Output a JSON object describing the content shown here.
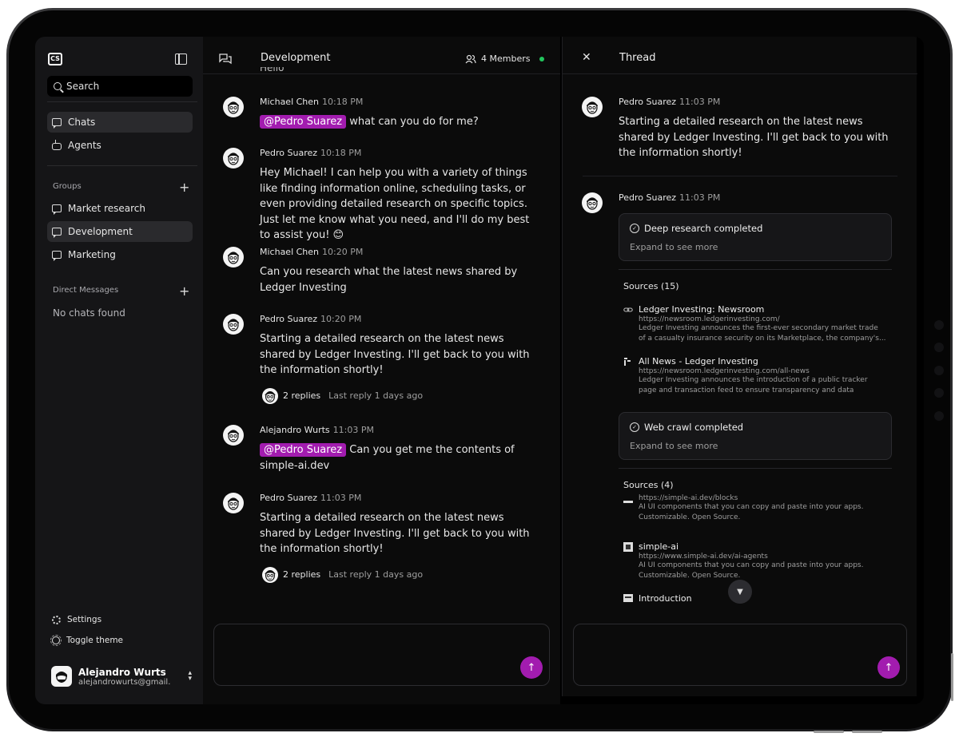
{
  "sidebar": {
    "logo_text": "CS",
    "search_label": "Search",
    "nav": [
      {
        "label": "Chats",
        "icon": "chat-icon",
        "active": true
      },
      {
        "label": "Agents",
        "icon": "bot-icon",
        "active": false
      }
    ],
    "groups_label": "Groups",
    "groups": [
      {
        "label": "Market research",
        "active": false
      },
      {
        "label": "Development",
        "active": true
      },
      {
        "label": "Marketing",
        "active": false
      }
    ],
    "dm_label": "Direct Messages",
    "dm_empty": "No chats found",
    "settings_label": "Settings",
    "theme_label": "Toggle theme",
    "user": {
      "name": "Alejandro Wurts",
      "email": "alejandrowurts@gmail.com"
    }
  },
  "chat": {
    "title": "Development",
    "members": "4 Members",
    "cut_text": "Hello",
    "messages": [
      {
        "author": "Michael Chen",
        "time": "10:18 PM",
        "mention": "@Pedro Suarez",
        "text": "what can you do for me?"
      },
      {
        "author": "Pedro Suarez",
        "time": "10:18 PM",
        "text": "Hey Michael! I can help you with a variety of things like finding information online, scheduling tasks, or even providing detailed research on specific topics. Just let me know what you need, and I'll do my best to assist you! 😊"
      },
      {
        "author": "Michael Chen",
        "time": "10:20 PM",
        "text": "Can you research what the latest news shared by Ledger Investing"
      },
      {
        "author": "Pedro Suarez",
        "time": "10:20 PM",
        "text": "Starting a detailed research on the latest news shared by Ledger Investing. I'll get back to you with the information shortly!",
        "replies": "2 replies",
        "last_reply": "Last reply 1 days ago"
      },
      {
        "author": "Alejandro Wurts",
        "time": "11:03 PM",
        "mention": "@Pedro Suarez",
        "text": "Can you get me the contents of simple-ai.dev"
      },
      {
        "author": "Pedro Suarez",
        "time": "11:03 PM",
        "text": "Starting a detailed research on the latest news shared by Ledger Investing. I'll get back to you with the information shortly!",
        "replies": "2 replies",
        "last_reply": "Last reply 1 days ago"
      }
    ]
  },
  "thread": {
    "title": "Thread",
    "messages": [
      {
        "author": "Pedro Suarez",
        "time": "11:03 PM",
        "text": "Starting a detailed research on the latest news shared by Ledger Investing. I'll get back to you with the information shortly!"
      },
      {
        "author": "Pedro Suarez",
        "time": "11:03 PM"
      }
    ],
    "tool1": {
      "title": "Deep research completed",
      "sub": "Expand to see more"
    },
    "sources1_label": "Sources (15)",
    "sources1": [
      {
        "title": "Ledger Investing: Newsroom",
        "url": "https://newsroom.ledgerinvesting.com/",
        "desc": "Ledger Investing announces the first-ever secondary market trade of a casualty insurance security on its Marketplace, the company's..."
      },
      {
        "title": "All News - Ledger Investing",
        "url": "https://newsroom.ledgerinvesting.com/all-news",
        "desc": "Ledger Investing announces the introduction of a public tracker page and transaction feed to ensure transparency and data engineering in..."
      }
    ],
    "tool2": {
      "title": "Web crawl completed",
      "sub": "Expand to see more"
    },
    "sources2_label": "Sources (4)",
    "sources2": [
      {
        "title": "",
        "url": "https://simple-ai.dev/blocks",
        "desc": "AI UI components that you can copy and paste into your apps. Customizable. Open Source."
      },
      {
        "title": "simple-ai",
        "url": "https://www.simple-ai.dev/ai-agents",
        "desc": "AI UI components that you can copy and paste into your apps. Customizable. Open Source."
      },
      {
        "title": "Introduction",
        "url": "",
        "desc": ""
      }
    ]
  },
  "colors": {
    "accent": "#a21caf",
    "online": "#22c55e",
    "background": "#0b0b0b",
    "sidebar": "#151517"
  }
}
